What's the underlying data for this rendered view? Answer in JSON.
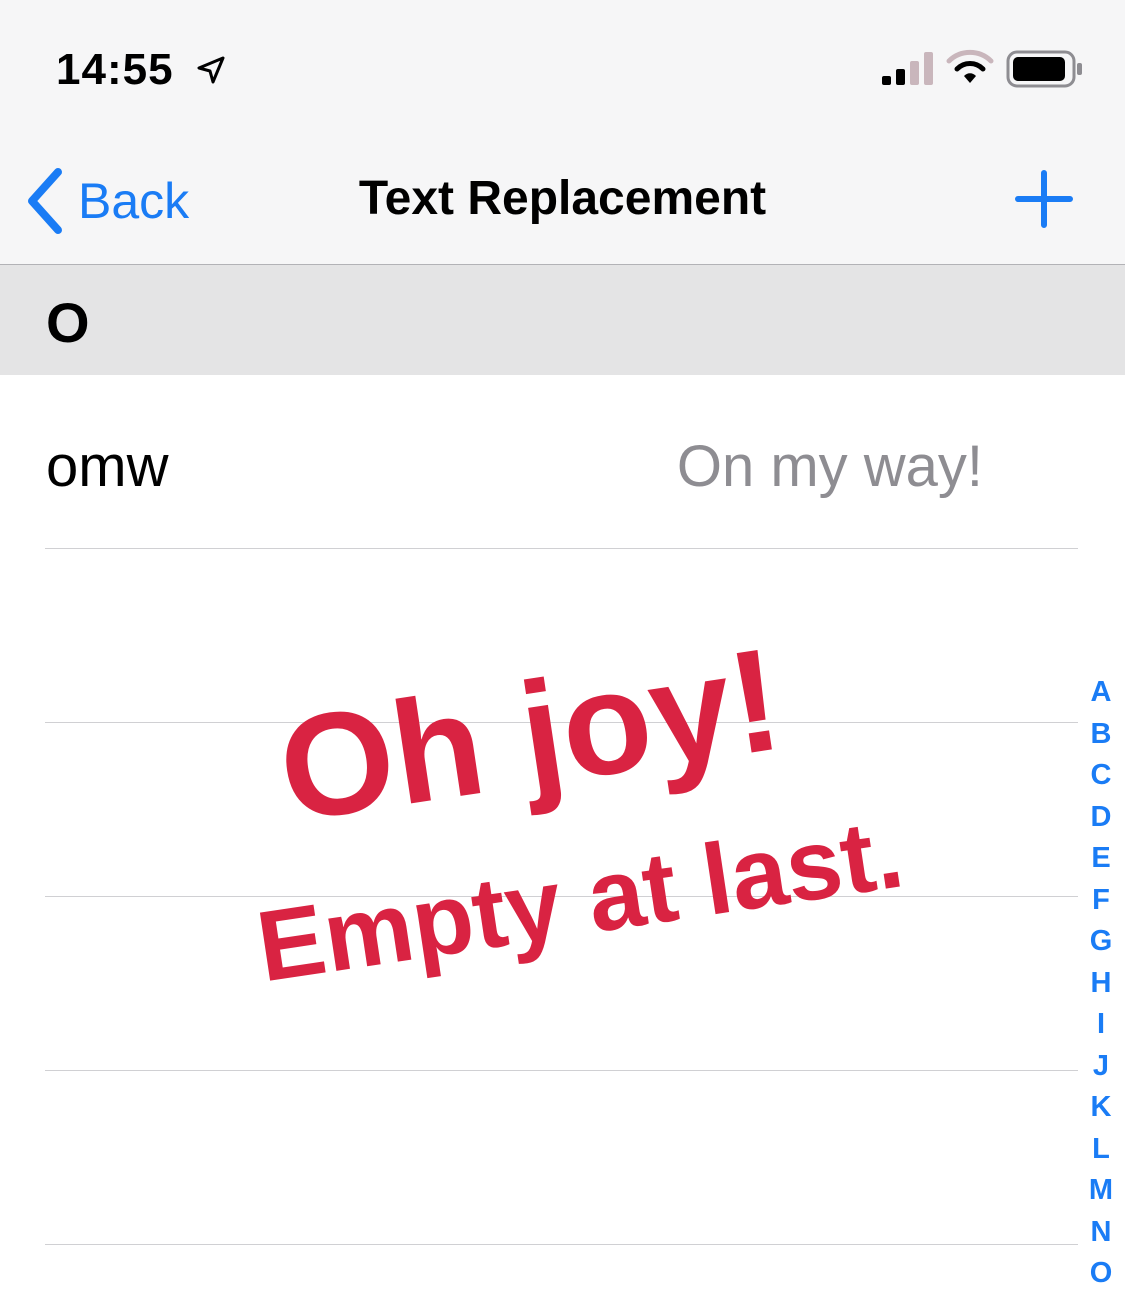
{
  "status_bar": {
    "time": "14:55",
    "icons": [
      "location-arrow-icon",
      "signal-icon",
      "wifi-icon",
      "battery-icon"
    ]
  },
  "nav": {
    "back_label": "Back",
    "title": "Text Replacement",
    "add_icon": "plus-icon"
  },
  "section": {
    "letter": "O"
  },
  "rows": [
    {
      "shortcut": "omw",
      "phrase": "On my way!"
    }
  ],
  "index": [
    "A",
    "B",
    "C",
    "D",
    "E",
    "F",
    "G",
    "H",
    "I",
    "J",
    "K",
    "L",
    "M",
    "N",
    "O"
  ],
  "overlay": {
    "headline": "Oh joy!",
    "subline": "Empty at last."
  },
  "colors": {
    "accent": "#1a7cf5",
    "overlay": "#d92342",
    "secondary_text": "#8e8d92",
    "section_bg": "#e4e4e5",
    "bar_bg": "#f6f6f7"
  }
}
